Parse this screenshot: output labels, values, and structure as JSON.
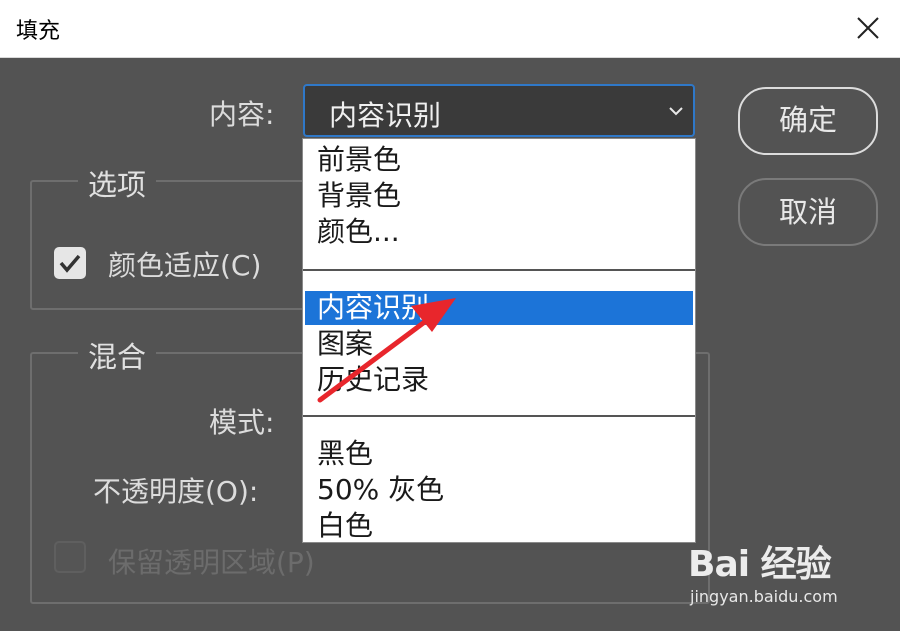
{
  "window": {
    "title": "填充"
  },
  "content": {
    "label": "内容:",
    "selected_value": "内容识别"
  },
  "buttons": {
    "ok_label": "确定",
    "cancel_label": "取消"
  },
  "options_group": {
    "title": "选项",
    "color_adapt_label": "颜色适应(C)",
    "color_adapt_checked": true
  },
  "blend_group": {
    "title": "混合",
    "mode_label": "模式:",
    "opacity_label": "不透明度(O):",
    "preserve_label": "保留透明区域(P)",
    "preserve_checked": false,
    "preserve_enabled": false
  },
  "dropdown": {
    "items": [
      "前景色",
      "背景色",
      "颜色...",
      "内容识别",
      "图案",
      "历史记录",
      "黑色",
      "50% 灰色",
      "白色"
    ],
    "selected_index": 3
  },
  "watermark": {
    "logo": "Bai 经验",
    "url": "jingyan.baidu.com"
  },
  "colors": {
    "accent": "#1c74d8",
    "arrow": "#e8262c",
    "dialog_bg": "#535353"
  }
}
